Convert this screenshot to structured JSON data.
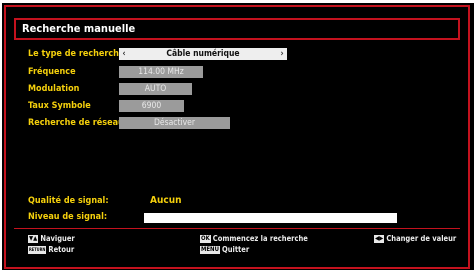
{
  "title": "Recherche manuelle",
  "fields": [
    {
      "label": "Le type de recherche",
      "value": "Câble numérique"
    },
    {
      "label": "Fréquence",
      "value": "114.00 MHz"
    },
    {
      "label": "Modulation",
      "value": "AUTO"
    },
    {
      "label": "Taux Symbole",
      "value": "6900"
    },
    {
      "label": "Recherche de réseau",
      "value": "Désactiver"
    }
  ],
  "signal": {
    "quality_label": "Qualité de signal:",
    "quality_value": "Aucun",
    "level_label": "Niveau de signal:"
  },
  "footer": {
    "navigate": "Naviguer",
    "back": "Retour",
    "start": "Commencez la recherche",
    "quit": "Quitter",
    "change": "Changer de valeur",
    "key_ok": "OK",
    "key_menu": "MENU",
    "key_return": "RETURN"
  },
  "colors": {
    "accent": "#c4121e",
    "label": "#f5d00c"
  }
}
